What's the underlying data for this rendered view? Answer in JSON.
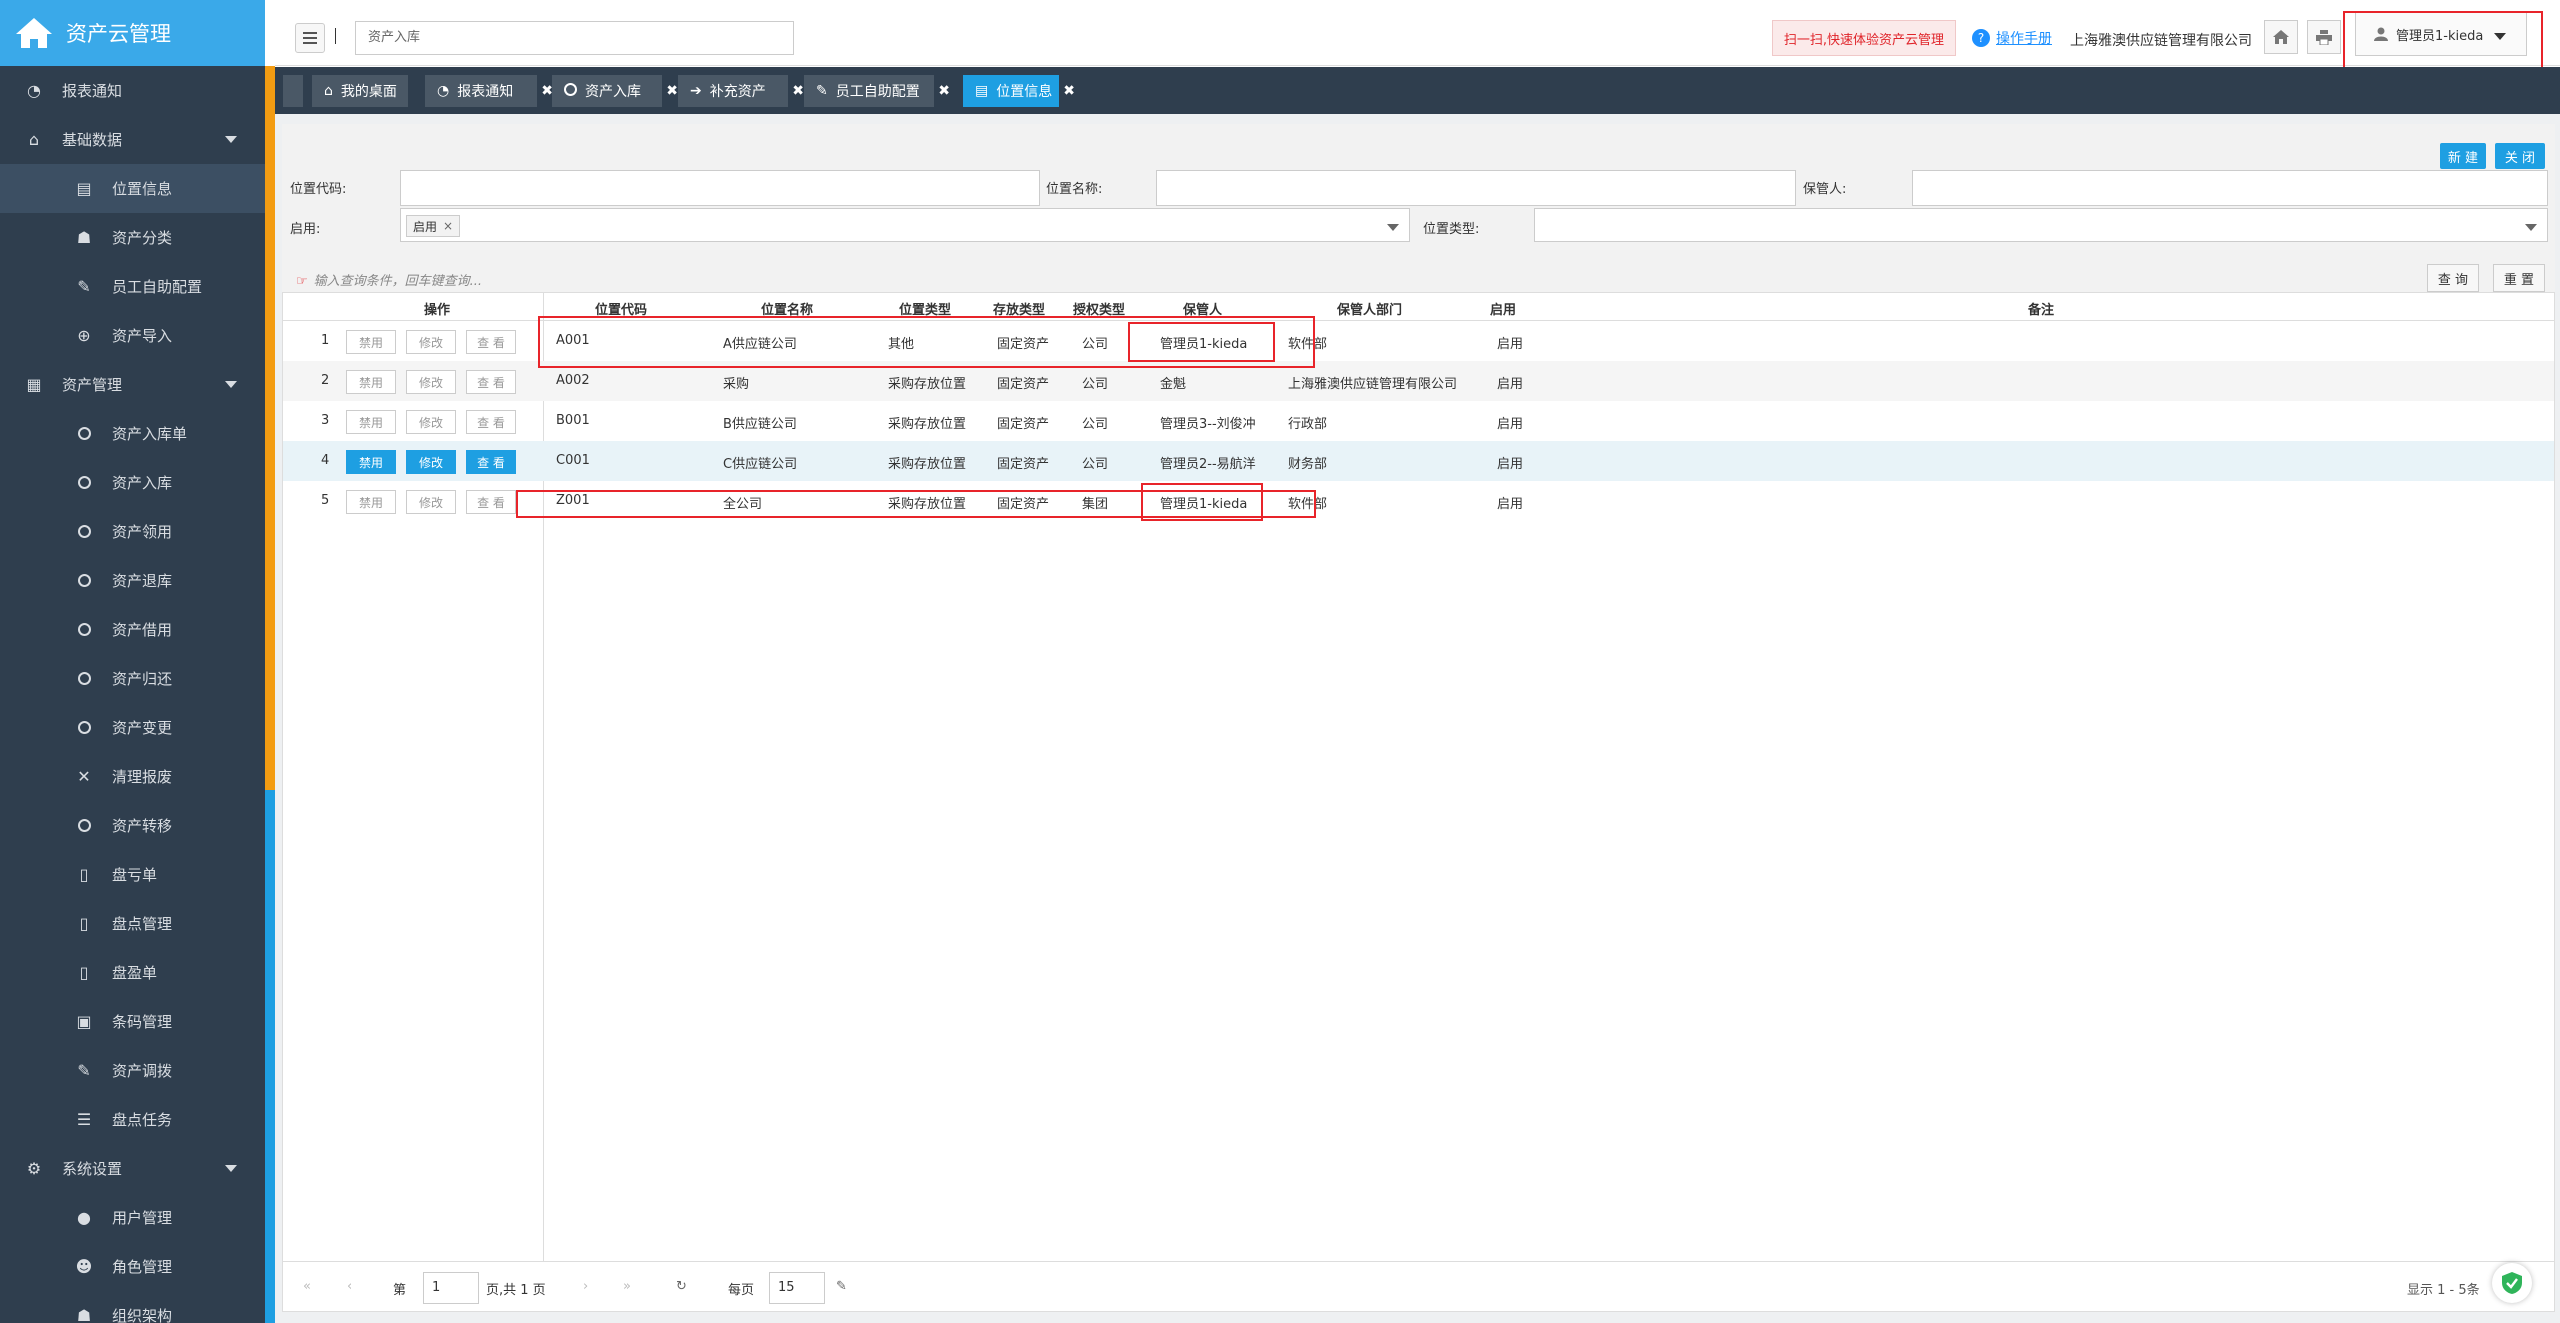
{
  "app": {
    "title": "资产云管理"
  },
  "sidebar": {
    "items": [
      {
        "label": "报表通知",
        "icon": "dashboard-icon",
        "level": "top"
      },
      {
        "label": "基础数据",
        "icon": "home-icon",
        "level": "top",
        "expandable": true
      },
      {
        "label": "位置信息",
        "icon": "building-icon",
        "level": "sub",
        "active": true
      },
      {
        "label": "资产分类",
        "icon": "sitemap-icon",
        "level": "sub"
      },
      {
        "label": "员工自助配置",
        "icon": "edit-icon",
        "level": "sub"
      },
      {
        "label": "资产导入",
        "icon": "plus-circle-icon",
        "level": "sub"
      },
      {
        "label": "资产管理",
        "icon": "grid-icon",
        "level": "top",
        "expandable": true
      },
      {
        "label": "资产入库单",
        "icon": "circle-icon",
        "level": "sub"
      },
      {
        "label": "资产入库",
        "icon": "circle-icon",
        "level": "sub"
      },
      {
        "label": "资产领用",
        "icon": "circle-icon",
        "level": "sub"
      },
      {
        "label": "资产退库",
        "icon": "circle-icon",
        "level": "sub"
      },
      {
        "label": "资产借用",
        "icon": "circle-icon",
        "level": "sub"
      },
      {
        "label": "资产归还",
        "icon": "circle-icon",
        "level": "sub"
      },
      {
        "label": "资产变更",
        "icon": "circle-icon",
        "level": "sub"
      },
      {
        "label": "清理报废",
        "icon": "close-icon",
        "level": "sub"
      },
      {
        "label": "资产转移",
        "icon": "circle-icon",
        "level": "sub"
      },
      {
        "label": "盘亏单",
        "icon": "file-icon",
        "level": "sub"
      },
      {
        "label": "盘点管理",
        "icon": "file-icon",
        "level": "sub"
      },
      {
        "label": "盘盈单",
        "icon": "file-icon",
        "level": "sub"
      },
      {
        "label": "条码管理",
        "icon": "qrcode-icon",
        "level": "sub"
      },
      {
        "label": "资产调拨",
        "icon": "edit-icon",
        "level": "sub"
      },
      {
        "label": "盘点任务",
        "icon": "list-icon",
        "level": "sub"
      },
      {
        "label": "系统设置",
        "icon": "gears-icon",
        "level": "top",
        "expandable": true
      },
      {
        "label": "用户管理",
        "icon": "user-icon",
        "level": "sub"
      },
      {
        "label": "角色管理",
        "icon": "users-icon",
        "level": "sub"
      },
      {
        "label": "组织架构",
        "icon": "sitemap-icon",
        "level": "sub"
      }
    ]
  },
  "header": {
    "search_value": "资产入库",
    "scan_label": "扫一扫,快速体验资产云管理",
    "help_label": "操作手册",
    "company": "上海雅澳供应链管理有限公司",
    "user": "管理员1-kieda"
  },
  "tabs": [
    {
      "label": "我的桌面",
      "icon": "home-icon",
      "closable": false
    },
    {
      "label": "报表通知",
      "icon": "dashboard-icon",
      "closable": true
    },
    {
      "label": "资产入库",
      "icon": "circle-icon",
      "closable": true
    },
    {
      "label": "补充资产",
      "icon": "sign-in-icon",
      "closable": true
    },
    {
      "label": "员工自助配置",
      "icon": "edit-icon",
      "closable": true
    },
    {
      "label": "位置信息",
      "icon": "building-icon",
      "closable": true,
      "active": true
    }
  ],
  "toolbar": {
    "new_label": "新 建",
    "close_label": "关 闭"
  },
  "filters": {
    "code_label": "位置代码:",
    "name_label": "位置名称:",
    "keeper_label": "保管人:",
    "enabled_label": "启用:",
    "enabled_tag": "启用",
    "type_label": "位置类型:",
    "hint": "输入查询条件，回车键查询...",
    "query_label": "查 询",
    "reset_label": "重 置"
  },
  "table": {
    "headers": {
      "ops": "操作",
      "code": "位置代码",
      "name": "位置名称",
      "type": "位置类型",
      "storage": "存放类型",
      "auth": "授权类型",
      "keeper": "保管人",
      "dept": "保管人部门",
      "enabled": "启用",
      "remark": "备注"
    },
    "op_labels": {
      "disable": "禁用",
      "edit": "修改",
      "view": "查 看"
    },
    "rows": [
      {
        "no": "1",
        "code": "A001",
        "name": "A供应链公司",
        "type": "其他",
        "storage": "固定资产",
        "auth": "公司",
        "keeper": "管理员1-kieda",
        "dept": "软件部",
        "enabled": "启用"
      },
      {
        "no": "2",
        "code": "A002",
        "name": "采购",
        "type": "采购存放位置",
        "storage": "固定资产",
        "auth": "公司",
        "keeper": "金魁",
        "dept": "上海雅澳供应链管理有限公司",
        "enabled": "启用"
      },
      {
        "no": "3",
        "code": "B001",
        "name": "B供应链公司",
        "type": "采购存放位置",
        "storage": "固定资产",
        "auth": "公司",
        "keeper": "管理员3--刘俊冲",
        "dept": "行政部",
        "enabled": "启用"
      },
      {
        "no": "4",
        "code": "C001",
        "name": "C供应链公司",
        "type": "采购存放位置",
        "storage": "固定资产",
        "auth": "公司",
        "keeper": "管理员2--易航洋",
        "dept": "财务部",
        "enabled": "启用"
      },
      {
        "no": "5",
        "code": "Z001",
        "name": "全公司",
        "type": "采购存放位置",
        "storage": "固定资产",
        "auth": "集团",
        "keeper": "管理员1-kieda",
        "dept": "软件部",
        "enabled": "启用"
      }
    ]
  },
  "pager": {
    "page_prefix": "第",
    "page_value": "1",
    "page_suffix": "页,共 1 页",
    "per_page_label": "每页",
    "per_page_value": "15",
    "summary": "显示 1 - 5条"
  }
}
